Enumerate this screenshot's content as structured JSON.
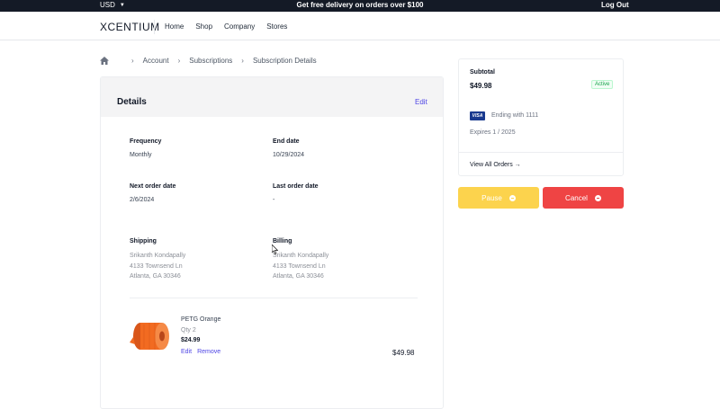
{
  "topbar": {
    "currency": "USD",
    "promo": "Get free delivery on orders over $100",
    "logout": "Log Out"
  },
  "header": {
    "logo": "XCENTIUM",
    "nav": [
      "Home",
      "Shop",
      "Company",
      "Stores"
    ]
  },
  "breadcrumb": [
    "Account",
    "Subscriptions",
    "Subscription Details"
  ],
  "details": {
    "title": "Details",
    "edit": "Edit",
    "frequency": {
      "label": "Frequency",
      "value": "Monthly"
    },
    "end_date": {
      "label": "End date",
      "value": "10/29/2024"
    },
    "next_order": {
      "label": "Next order date",
      "value": "2/6/2024"
    },
    "last_order": {
      "label": "Last order date",
      "value": "-"
    },
    "shipping": {
      "label": "Shipping",
      "name": "Srikanth Kondapally",
      "street": "4133 Townsend Ln",
      "city": "Atlanta, GA 30346"
    },
    "billing": {
      "label": "Billing",
      "name": "Srikanth Kondapally",
      "street": "4133 Townsend Ln",
      "city": "Atlanta, GA 30346"
    },
    "product": {
      "name": "PETG Orange",
      "qty": "Qty 2",
      "price": "$24.99",
      "edit": "Edit",
      "remove": "Remove",
      "total": "$49.98",
      "color": "#f26b21"
    }
  },
  "summary": {
    "subtotal_label": "Subtotal",
    "subtotal": "$49.98",
    "status": "Active",
    "card_brand": "VISA",
    "ending": "Ending with 1111",
    "expires": "Expires 1 / 2025",
    "view_all": "View All Orders →"
  },
  "actions": {
    "pause": "Pause",
    "cancel": "Cancel"
  },
  "colors": {
    "accent": "#4f46e5",
    "pause": "#fcd34d",
    "cancel": "#ef4444",
    "topbar": "#141a26"
  }
}
